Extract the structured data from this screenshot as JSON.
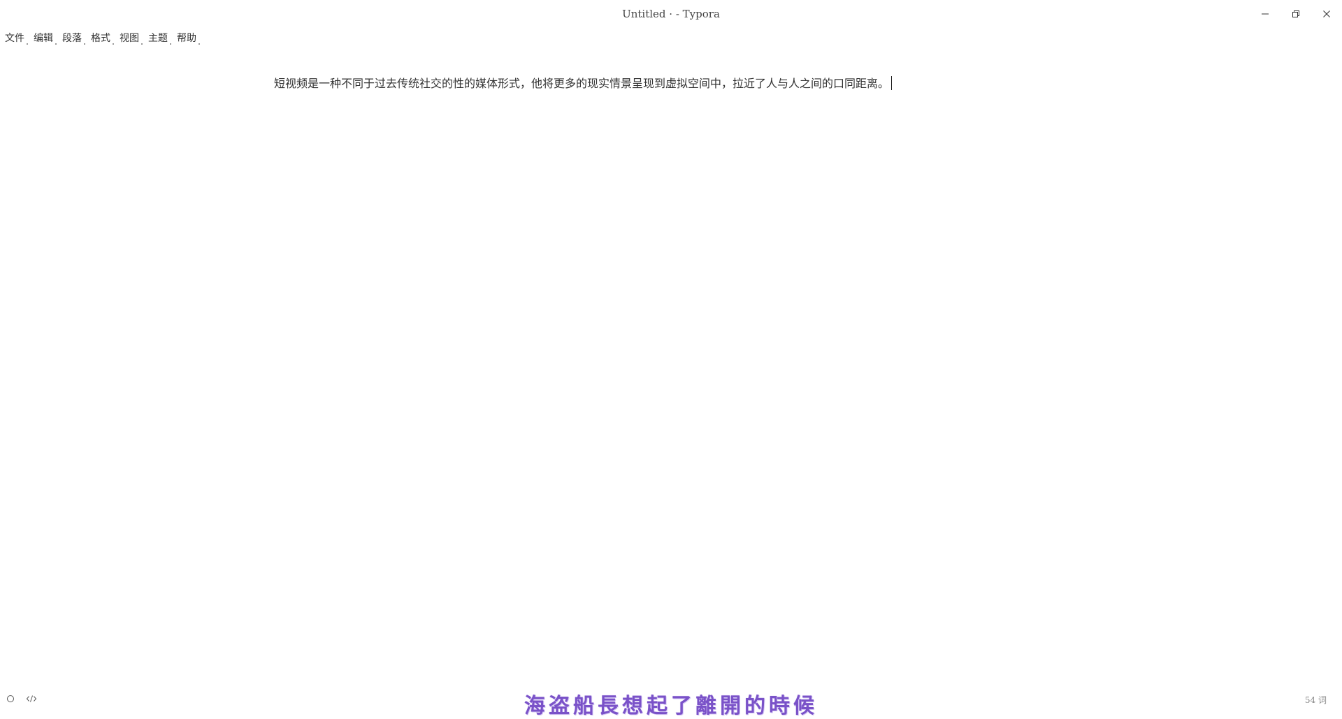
{
  "window": {
    "title": "Untitled · - Typora",
    "controls": {
      "minimize_icon": "minimize-icon",
      "restore_icon": "restore-icon",
      "close_icon": "close-icon"
    }
  },
  "menubar": {
    "items": [
      {
        "label": "文件"
      },
      {
        "label": "编辑"
      },
      {
        "label": "段落"
      },
      {
        "label": "格式"
      },
      {
        "label": "视图"
      },
      {
        "label": "主题"
      },
      {
        "label": "帮助"
      }
    ]
  },
  "editor": {
    "paragraph": "短视频是一种不同于过去传统社交的性的媒体形式，他将更多的现实情景呈现到虚拟空间中，拉近了人与人之间的口同距离。"
  },
  "statusbar": {
    "outline_icon": "circle-icon",
    "source_icon": "code-icon",
    "word_count": "54 词"
  },
  "overlay": {
    "subtitle": "海盗船長想起了離開的時候"
  },
  "colors": {
    "subtitle": "#7a52c8",
    "text": "#333333",
    "background": "#ffffff"
  }
}
